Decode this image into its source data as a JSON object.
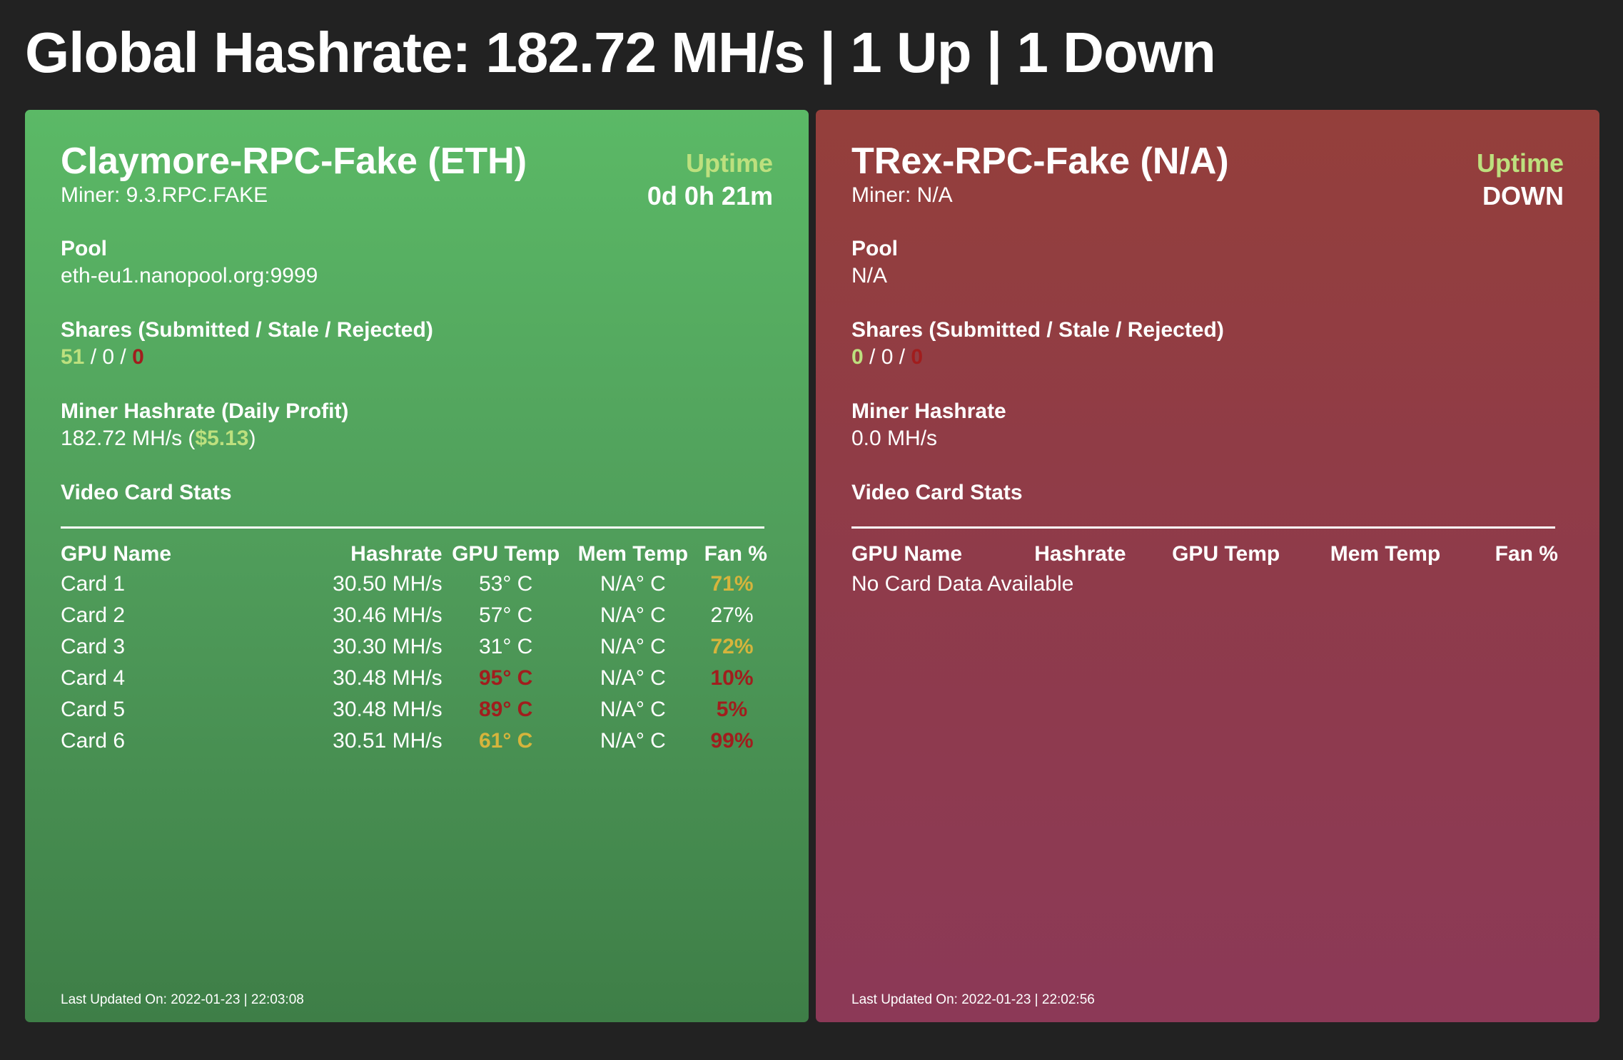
{
  "header": {
    "title": "Global Hashrate: 182.72 MH/s | 1 Up | 1 Down"
  },
  "colors": {
    "good": "#bde07e",
    "bad": "#a11d1d",
    "warn": "#d6b43c"
  },
  "labels": {
    "uptime": "Uptime",
    "pool": "Pool",
    "shares": "Shares (Submitted / Stale / Rejected)",
    "video": "Video Card Stats",
    "sep": " / "
  },
  "columns": [
    "GPU Name",
    "Hashrate",
    "GPU Temp",
    "Mem Temp",
    "Fan %"
  ],
  "miners": [
    {
      "name": "Claymore-RPC-Fake (ETH)",
      "miner": "Miner: 9.3.RPC.FAKE",
      "uptime": "0d 0h 21m",
      "pool": "eth-eu1.nanopool.org:9999",
      "shares": {
        "submitted": "51",
        "stale": "0",
        "rejected": "0"
      },
      "hashrate_label": "Miner Hashrate (Daily Profit)",
      "hashrate": "182.72 MH/s (",
      "profit": "$5.13",
      "hashrate_end": ")",
      "cards": [
        {
          "name": "Card 1",
          "hashrate": "30.50 MH/s",
          "gpu_temp": "53° C",
          "gpu_status": "",
          "mem_temp": "N/A° C",
          "fan": "71%",
          "fan_status": "y"
        },
        {
          "name": "Card 2",
          "hashrate": "30.46 MH/s",
          "gpu_temp": "57° C",
          "gpu_status": "",
          "mem_temp": "N/A° C",
          "fan": "27%",
          "fan_status": ""
        },
        {
          "name": "Card 3",
          "hashrate": "30.30 MH/s",
          "gpu_temp": "31° C",
          "gpu_status": "",
          "mem_temp": "N/A° C",
          "fan": "72%",
          "fan_status": "y"
        },
        {
          "name": "Card 4",
          "hashrate": "30.48 MH/s",
          "gpu_temp": "95° C",
          "gpu_status": "r",
          "mem_temp": "N/A° C",
          "fan": "10%",
          "fan_status": "r"
        },
        {
          "name": "Card 5",
          "hashrate": "30.48 MH/s",
          "gpu_temp": "89° C",
          "gpu_status": "r",
          "mem_temp": "N/A° C",
          "fan": "5%",
          "fan_status": "r"
        },
        {
          "name": "Card 6",
          "hashrate": "30.51 MH/s",
          "gpu_temp": "61° C",
          "gpu_status": "y",
          "mem_temp": "N/A° C",
          "fan": "99%",
          "fan_status": "r"
        }
      ],
      "footer": "Last Updated On: 2022-01-23 | 22:03:08"
    },
    {
      "name": "TRex-RPC-Fake (N/A)",
      "miner": "Miner: N/A",
      "uptime": "DOWN",
      "pool": "N/A",
      "shares": {
        "submitted": "0",
        "stale": "0",
        "rejected": "0"
      },
      "hashrate_label": "Miner Hashrate",
      "hashrate": "0.0 MH/s",
      "no_cards": "No Card Data Available",
      "footer": "Last Updated On: 2022-01-23 | 22:02:56"
    }
  ]
}
